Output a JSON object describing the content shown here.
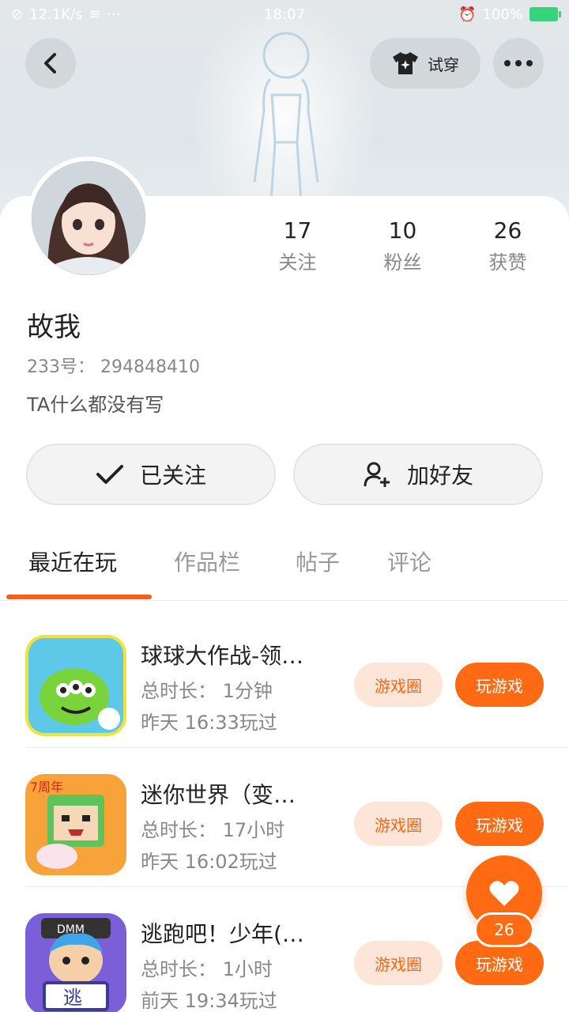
{
  "status_bar": {
    "speed": "12.1K/s",
    "time": "18:07",
    "battery": "100%"
  },
  "header": {
    "tryon_label": "试穿"
  },
  "profile": {
    "name": "故我",
    "id_text": "233号： 294848410",
    "bio": "TA什么都没有写",
    "stats": [
      {
        "value": "17",
        "label": "关注"
      },
      {
        "value": "10",
        "label": "粉丝"
      },
      {
        "value": "26",
        "label": "获赞"
      }
    ]
  },
  "actions": {
    "follow_label": "已关注",
    "add_friend_label": "加好友"
  },
  "tabs": [
    "最近在玩",
    "作品栏",
    "帖子",
    "评论"
  ],
  "games": [
    {
      "name": "球球大作战-领…",
      "duration": "总时长： 1分钟",
      "last_played": "昨天 16:33玩过",
      "circle_label": "游戏圈",
      "play_label": "玩游戏"
    },
    {
      "name": "迷你世界（变…",
      "duration": "总时长： 17小时",
      "last_played": "昨天 16:02玩过",
      "circle_label": "游戏圈",
      "play_label": "玩游戏"
    },
    {
      "name": "逃跑吧！少年(…",
      "duration": "总时长： 1小时",
      "last_played": "前天 19:34玩过",
      "circle_label": "游戏圈",
      "play_label": "玩游戏"
    }
  ],
  "like_count": "26",
  "colors": {
    "accent": "#ff6a12",
    "accent_light": "#fde5d8"
  }
}
